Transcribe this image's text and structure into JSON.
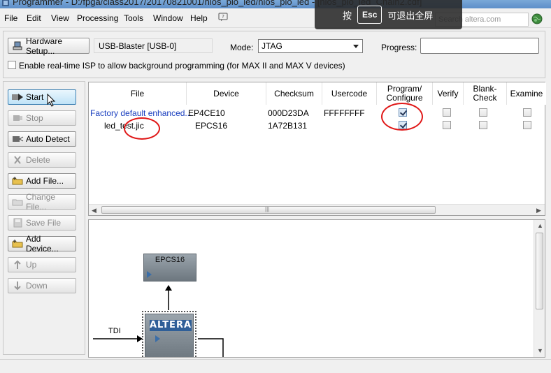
{
  "window": {
    "title": "Programmer - D:/fpga/class2017/20170821001/nios_pio_led/nios_pio_led - [nios_pio_led_Chain2.cdf]"
  },
  "esc_hint": {
    "key": "Esc",
    "before": "按",
    "after": "可退出全屏"
  },
  "menu": [
    "File",
    "Edit",
    "View",
    "Processing",
    "Tools",
    "Window",
    "Help"
  ],
  "search": {
    "placeholder": "Search altera.com"
  },
  "toolbar": {
    "hardware_setup_label": "Hardware Setup...",
    "hardware_value": "USB-Blaster [USB-0]",
    "mode_label": "Mode:",
    "mode_value": "JTAG",
    "progress_label": "Progress:",
    "isp_label": "Enable real-time ISP to allow background programming (for MAX II and MAX V devices)"
  },
  "side_buttons": [
    {
      "label": "Start",
      "enabled": true
    },
    {
      "label": "Stop",
      "enabled": false
    },
    {
      "label": "Auto Detect",
      "enabled": true
    },
    {
      "label": "Delete",
      "enabled": false
    },
    {
      "label": "Add File...",
      "enabled": true
    },
    {
      "label": "Change File...",
      "enabled": false
    },
    {
      "label": "Save File",
      "enabled": false
    },
    {
      "label": "Add Device...",
      "enabled": true
    },
    {
      "label": "Up",
      "enabled": false
    },
    {
      "label": "Down",
      "enabled": false
    }
  ],
  "table": {
    "columns": [
      "File",
      "Device",
      "Checksum",
      "Usercode",
      "Program/\nConfigure",
      "Verify",
      "Blank-\nCheck",
      "Examine"
    ],
    "rows": [
      {
        "file": "Factory default enhanced...",
        "device": "EP4CE10",
        "checksum": "000D23DA",
        "usercode": "FFFFFFFF",
        "program": true,
        "verify": false,
        "blank": false,
        "examine": false
      },
      {
        "file": "led_test.jic",
        "device": "EPCS16",
        "checksum": "1A72B131",
        "usercode": "",
        "program": true,
        "verify": false,
        "blank": false,
        "examine": false
      }
    ]
  },
  "diagram": {
    "flash_label": "EPCS16",
    "fpga_logo": "ALTERA",
    "tdi_label": "TDI"
  },
  "colors": {
    "link_blue": "#1a3fbf",
    "annotation_red": "#e01818",
    "titlebar": "#6d9bd0"
  }
}
